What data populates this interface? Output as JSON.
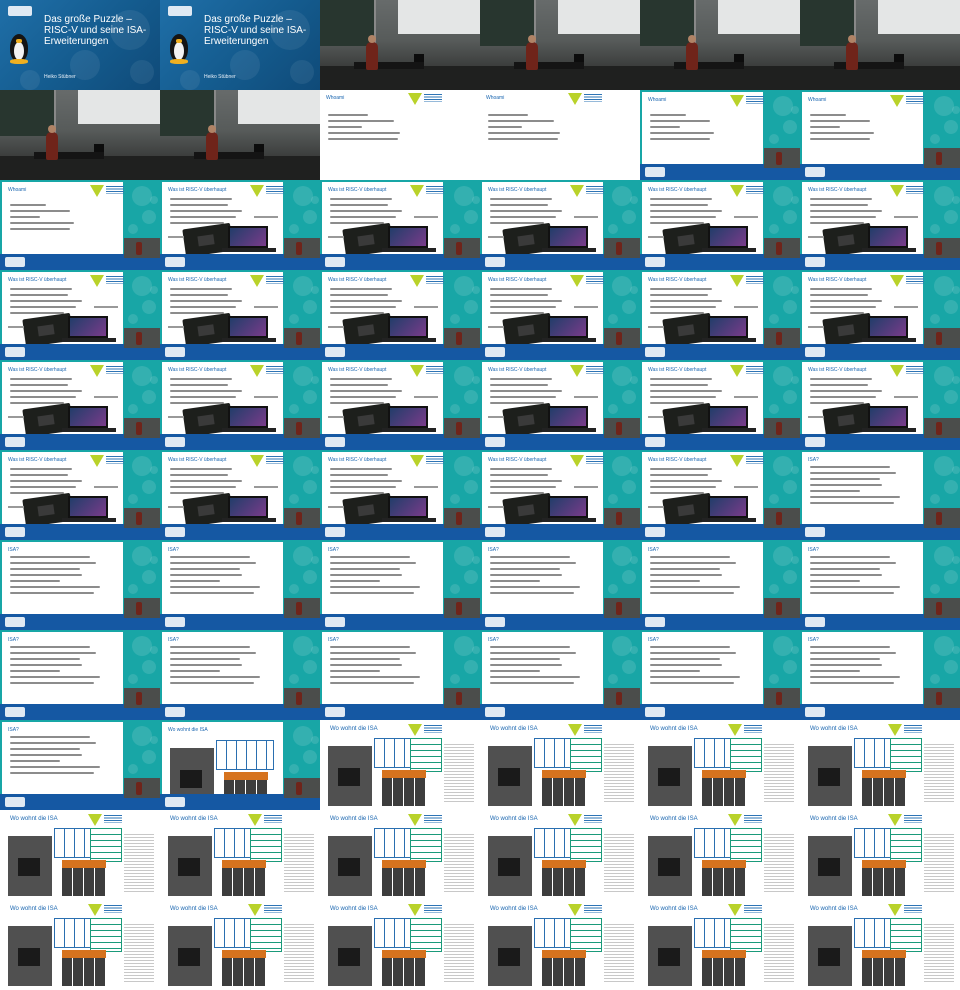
{
  "sheet": {
    "rows": 11,
    "cols": 6
  },
  "colors": {
    "brand_blue": "#1558a3",
    "teal": "#18a6a6",
    "accent_green": "#b9d22a",
    "orange": "#d6731e"
  },
  "title_slide": {
    "title": "Das große Puzzle – RISC-V und seine ISA-Erweiterungen",
    "author": "Heiko Stübner"
  },
  "headings": {
    "whoami": "Whoami",
    "risc": "Was ist RISC-V überhaupt",
    "isa": "ISA?",
    "wohnt": "Wo wohnt die ISA"
  },
  "thumbnails": [
    {
      "kind": "title"
    },
    {
      "kind": "title"
    },
    {
      "kind": "hall"
    },
    {
      "kind": "hall"
    },
    {
      "kind": "hall"
    },
    {
      "kind": "hall"
    },
    {
      "kind": "hall"
    },
    {
      "kind": "hall"
    },
    {
      "kind": "whoami-white"
    },
    {
      "kind": "whoami-white"
    },
    {
      "kind": "whoami-teal"
    },
    {
      "kind": "whoami-teal"
    },
    {
      "kind": "whoami-teal"
    },
    {
      "kind": "risc"
    },
    {
      "kind": "risc"
    },
    {
      "kind": "risc"
    },
    {
      "kind": "risc"
    },
    {
      "kind": "risc"
    },
    {
      "kind": "risc"
    },
    {
      "kind": "risc"
    },
    {
      "kind": "risc"
    },
    {
      "kind": "risc"
    },
    {
      "kind": "risc"
    },
    {
      "kind": "risc"
    },
    {
      "kind": "risc"
    },
    {
      "kind": "risc"
    },
    {
      "kind": "risc"
    },
    {
      "kind": "risc"
    },
    {
      "kind": "risc"
    },
    {
      "kind": "risc"
    },
    {
      "kind": "risc"
    },
    {
      "kind": "risc"
    },
    {
      "kind": "risc"
    },
    {
      "kind": "risc"
    },
    {
      "kind": "risc"
    },
    {
      "kind": "isa"
    },
    {
      "kind": "isa"
    },
    {
      "kind": "isa"
    },
    {
      "kind": "isa"
    },
    {
      "kind": "isa"
    },
    {
      "kind": "isa"
    },
    {
      "kind": "isa"
    },
    {
      "kind": "isa"
    },
    {
      "kind": "isa"
    },
    {
      "kind": "isa"
    },
    {
      "kind": "isa"
    },
    {
      "kind": "isa"
    },
    {
      "kind": "isa"
    },
    {
      "kind": "isa"
    },
    {
      "kind": "wohnt-teal"
    },
    {
      "kind": "wohnt"
    },
    {
      "kind": "wohnt"
    },
    {
      "kind": "wohnt"
    },
    {
      "kind": "wohnt"
    },
    {
      "kind": "wohnt"
    },
    {
      "kind": "wohnt"
    },
    {
      "kind": "wohnt"
    },
    {
      "kind": "wohnt"
    },
    {
      "kind": "wohnt"
    },
    {
      "kind": "wohnt"
    },
    {
      "kind": "wohnt"
    },
    {
      "kind": "wohnt"
    },
    {
      "kind": "wohnt"
    },
    {
      "kind": "wohnt"
    },
    {
      "kind": "wohnt"
    },
    {
      "kind": "wohnt"
    }
  ]
}
